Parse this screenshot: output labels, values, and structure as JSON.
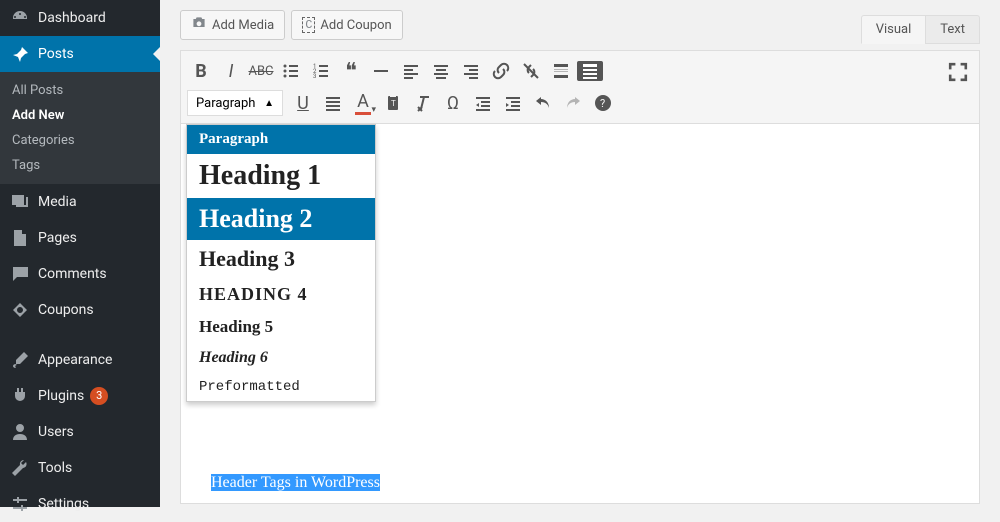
{
  "sidebar": {
    "dashboard": "Dashboard",
    "posts": "Posts",
    "sub": {
      "all": "All Posts",
      "add": "Add New",
      "cat": "Categories",
      "tags": "Tags"
    },
    "media": "Media",
    "pages": "Pages",
    "comments": "Comments",
    "coupons": "Coupons",
    "appearance": "Appearance",
    "plugins": "Plugins",
    "plugins_badge": "3",
    "users": "Users",
    "tools": "Tools",
    "settings": "Settings"
  },
  "media_row": {
    "add_media": "Add Media",
    "add_coupon": "Add Coupon"
  },
  "tabs": {
    "visual": "Visual",
    "text": "Text"
  },
  "format_select": {
    "current": "Paragraph"
  },
  "format_dropdown": [
    {
      "key": "p",
      "label": "Paragraph",
      "cls": "dd-p",
      "state": "sel"
    },
    {
      "key": "h1",
      "label": "Heading 1",
      "cls": "dd-h1",
      "state": ""
    },
    {
      "key": "h2",
      "label": "Heading 2",
      "cls": "dd-h2",
      "state": "hov"
    },
    {
      "key": "h3",
      "label": "Heading 3",
      "cls": "dd-h3",
      "state": ""
    },
    {
      "key": "h4",
      "label": "HEADING 4",
      "cls": "dd-h4",
      "state": ""
    },
    {
      "key": "h5",
      "label": "Heading 5",
      "cls": "dd-h5",
      "state": ""
    },
    {
      "key": "h6",
      "label": "Heading 6",
      "cls": "dd-h6",
      "state": ""
    },
    {
      "key": "pre",
      "label": "Preformatted",
      "cls": "dd-pre",
      "state": ""
    }
  ],
  "editor": {
    "selected_text": "Header Tags in WordPress"
  }
}
